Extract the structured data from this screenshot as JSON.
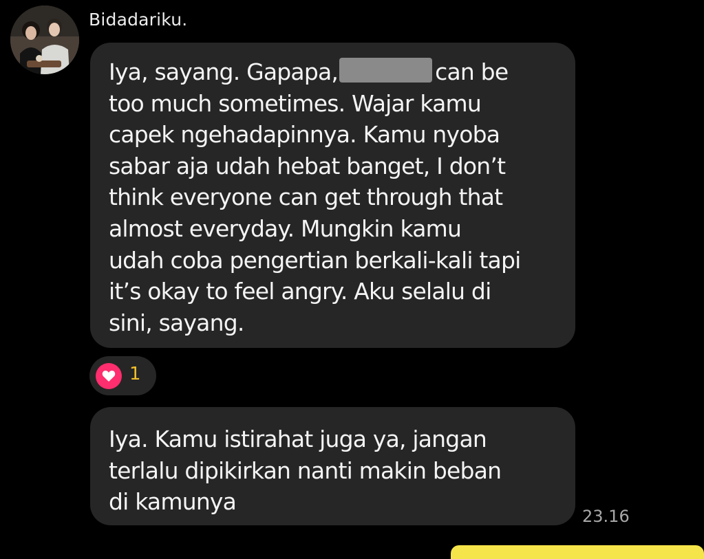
{
  "chat": {
    "sender_name": "Bidadariku.",
    "messages": [
      {
        "lines": [
          "Iya, sayang. Gapapa,",
          "can be",
          "too much sometimes. Wajar kamu",
          "capek ngehadapinnya. Kamu nyoba",
          "sabar aja udah hebat banget, I don’t",
          "think everyone can get through that",
          "almost everyday. Mungkin kamu",
          "udah coba pengertian berkali-kali tapi",
          "it’s okay to feel angry. Aku selalu di",
          "sini, sayang."
        ],
        "reaction": {
          "icon": "heart-icon",
          "count": "1",
          "color": "#ff2e6e"
        }
      },
      {
        "lines": [
          "Iya. Kamu istirahat juga ya, jangan",
          "terlalu dipikirkan nanti makin beban",
          "di kamunya"
        ],
        "time": "23.16"
      }
    ]
  },
  "theme": {
    "background": "#000000",
    "bubble": "#262626",
    "accent": "#f5e44a",
    "reaction_count_color": "#f2c02b"
  }
}
